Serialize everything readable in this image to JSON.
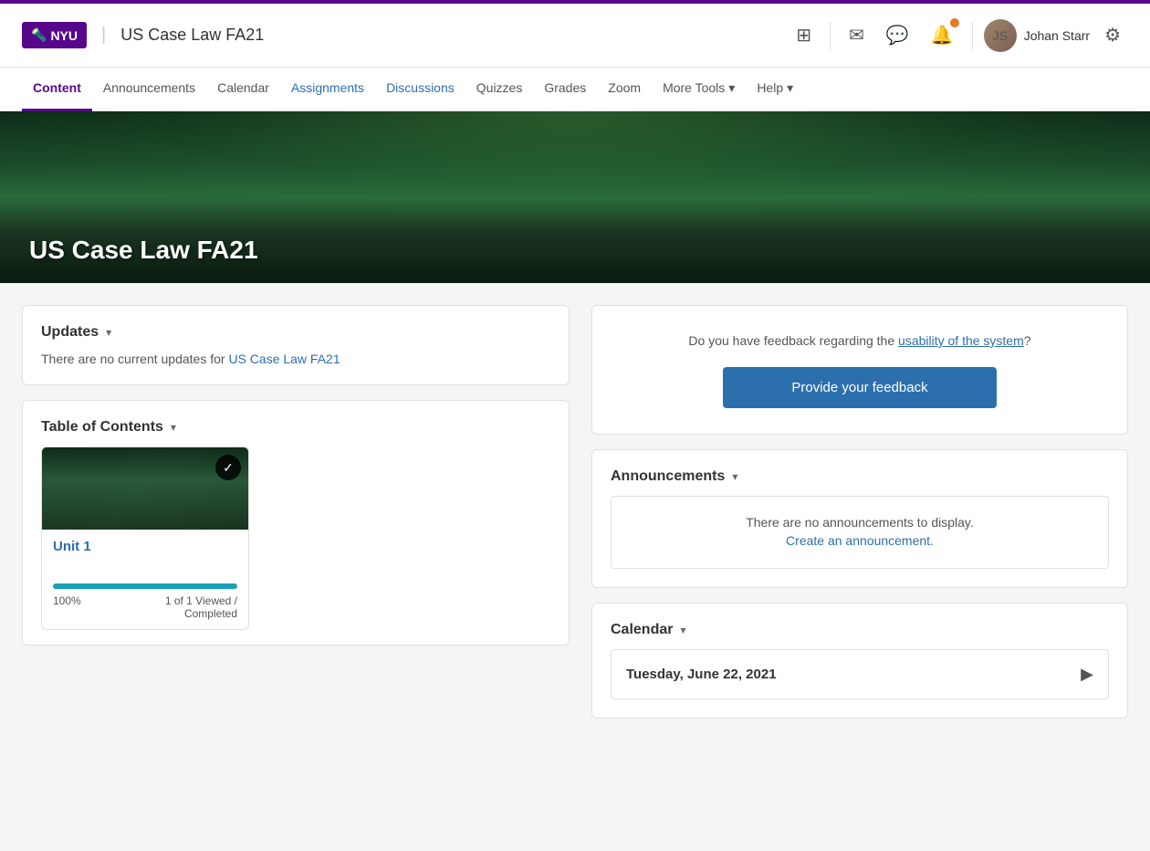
{
  "topBar": {},
  "header": {
    "logo": "NYU",
    "logoIcon": "🔦",
    "courseTitle": "US Case Law FA21",
    "icons": {
      "grid": "⊞",
      "mail": "✉",
      "chat": "💬",
      "bell": "🔔",
      "settings": "⚙"
    },
    "userName": "Johan Starr",
    "notifColor": "#e87722"
  },
  "nav": {
    "items": [
      {
        "label": "Content",
        "active": true,
        "blue": false
      },
      {
        "label": "Announcements",
        "active": false,
        "blue": false
      },
      {
        "label": "Calendar",
        "active": false,
        "blue": false
      },
      {
        "label": "Assignments",
        "active": false,
        "blue": true
      },
      {
        "label": "Discussions",
        "active": false,
        "blue": true
      },
      {
        "label": "Quizzes",
        "active": false,
        "blue": false
      },
      {
        "label": "Grades",
        "active": false,
        "blue": false
      },
      {
        "label": "Zoom",
        "active": false,
        "blue": false
      },
      {
        "label": "More Tools",
        "active": false,
        "blue": false,
        "dropdown": true
      },
      {
        "label": "Help",
        "active": false,
        "blue": false,
        "dropdown": true
      }
    ]
  },
  "hero": {
    "title": "US Case Law FA21"
  },
  "updates": {
    "header": "Updates",
    "text": "There are no current updates for ",
    "courseLink": "US Case Law FA21"
  },
  "toc": {
    "header": "Table of Contents",
    "unit": {
      "name": "Unit 1",
      "progress": 100,
      "progressLabel": "100%",
      "viewed": "1 of 1 Viewed /",
      "completed": "Completed",
      "checkIcon": "✓"
    }
  },
  "feedback": {
    "question": "Do you have feedback regarding the usability of the system?",
    "questionLink": "usability of the system",
    "buttonLabel": "Provide your feedback"
  },
  "announcements": {
    "header": "Announcements",
    "emptyText": "There are no announcements to display.",
    "createLink": "Create an announcement."
  },
  "calendar": {
    "header": "Calendar",
    "date": "Tuesday, June 22, 2021"
  }
}
